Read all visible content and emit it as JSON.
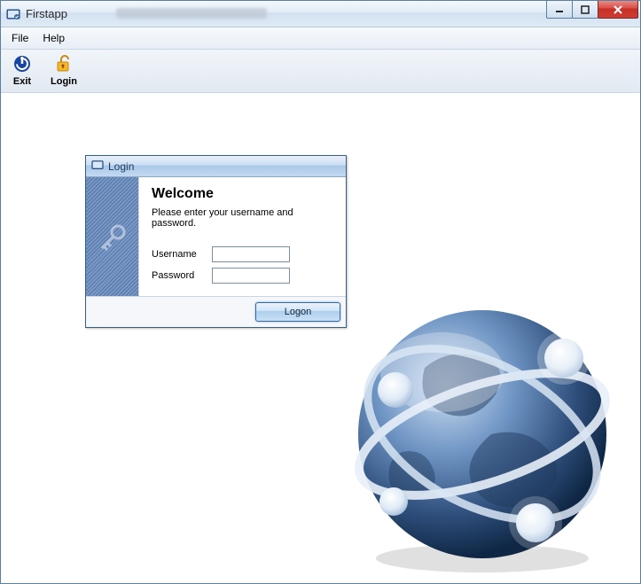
{
  "window": {
    "title": "Firstapp"
  },
  "menu": {
    "file": "File",
    "help": "Help"
  },
  "toolbar": {
    "exit_label": "Exit",
    "login_label": "Login"
  },
  "login": {
    "title": "Login",
    "welcome": "Welcome",
    "hint": "Please enter your username and password.",
    "username_label": "Username",
    "password_label": "Password",
    "username_value": "",
    "password_value": "",
    "logon_label": "Logon"
  }
}
